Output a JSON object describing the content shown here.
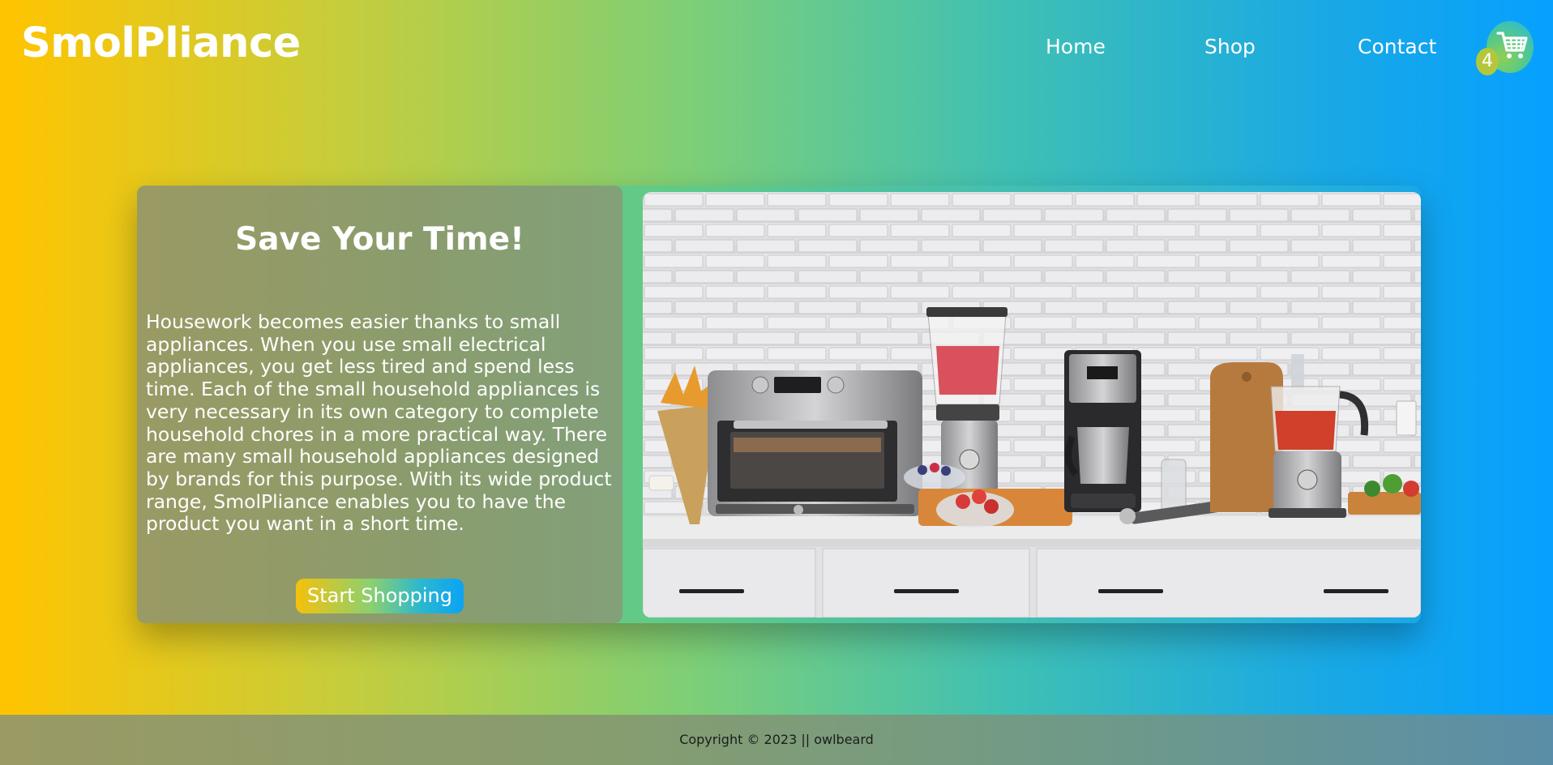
{
  "brand": {
    "name": "SmolPliance"
  },
  "nav": {
    "items": [
      "Home",
      "Shop",
      "Contact"
    ]
  },
  "cart": {
    "count": "4",
    "icon": "shopping-cart-icon"
  },
  "hero": {
    "title": "Save Your Time!",
    "description": "Housework becomes easier thanks to small appliances. When you use small electrical appliances, you get less tired and spend less time. Each of the small household appliances is very necessary in its own category to complete household chores in a more practical way. There are many small household appliances designed by brands for this purpose. With its wide product range, SmolPliance enables you to have the product you want in a short time.",
    "cta_label": "Start Shopping",
    "image": "kitchen-appliances-photo"
  },
  "footer": {
    "copyright": "Copyright © 2023 || owlbeard"
  },
  "colors": {
    "gradient_start": "#ffc400",
    "gradient_mid": "#7ccf78",
    "gradient_end": "#06a0ff",
    "panel": "#9a9a64"
  }
}
